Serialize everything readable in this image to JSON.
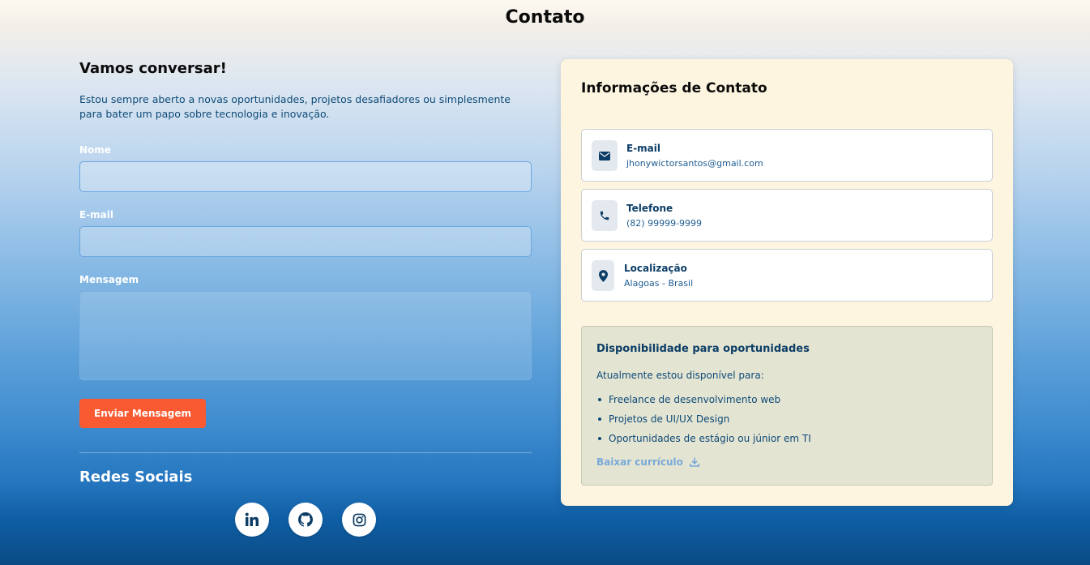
{
  "page": {
    "title": "Contato"
  },
  "form": {
    "heading": "Vamos conversar!",
    "intro": "Estou sempre aberto a novas oportunidades, projetos desafiadores ou simplesmente para bater um papo sobre tecnologia e inovação.",
    "name_label": "Nome",
    "name_value": "",
    "email_label": "E-mail",
    "email_value": "",
    "message_label": "Mensagem",
    "message_value": "",
    "submit_label": "Enviar Mensagem"
  },
  "social": {
    "title": "Redes Sociais",
    "links": [
      {
        "icon": "linkedin-icon"
      },
      {
        "icon": "github-icon"
      },
      {
        "icon": "instagram-icon"
      }
    ]
  },
  "contact_info": {
    "title": "Informações de Contato",
    "items": [
      {
        "icon": "envelope-icon",
        "label": "E-mail",
        "value": "jhonywictorsantos@gmail.com"
      },
      {
        "icon": "phone-icon",
        "label": "Telefone",
        "value": "(82) 99999-9999"
      },
      {
        "icon": "map-pin-icon",
        "label": "Localização",
        "value": "Alagoas - Brasil"
      }
    ]
  },
  "availability": {
    "title": "Disponibilidade para oportunidades",
    "subtitle": "Atualmente estou disponível para:",
    "items": [
      "Freelance de desenvolvimento web",
      "Projetos de UI/UX Design",
      "Oportunidades de estágio ou júnior em TI"
    ],
    "download_label": "Baixar currículo",
    "download_icon": "download-icon"
  },
  "colors": {
    "accent": "#fa5a31",
    "primary_dark": "#0b3d66",
    "card_bg": "#fdf5df",
    "availability_bg": "#e4e4d2",
    "link": "#79a9d9"
  }
}
